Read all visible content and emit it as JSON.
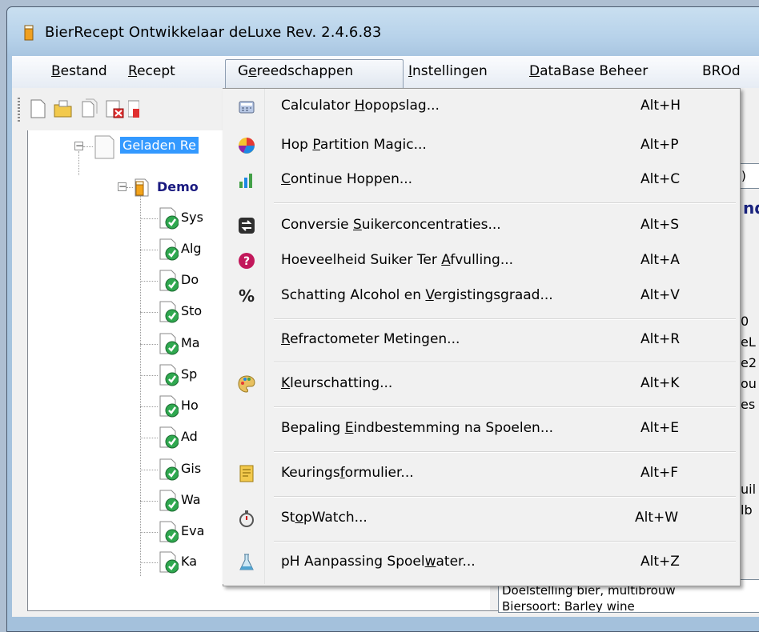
{
  "window": {
    "title": "BierRecept Ontwikkelaar deLuxe Rev. 2.4.6.83"
  },
  "menubar": {
    "items": [
      {
        "label": "Bestand",
        "mnemonic": "B",
        "rest": "estand"
      },
      {
        "label": "Recept",
        "mnemonic": "R",
        "rest": "ecept"
      },
      {
        "label": "Gereedschappen",
        "pre": "G",
        "mnemonic": "e",
        "rest": "reedschappen"
      },
      {
        "label": "Instellingen",
        "mnemonic": "I",
        "rest": "nstellingen"
      },
      {
        "label": "DataBase Beheer",
        "mnemonic": "D",
        "rest": "ataBase Beheer"
      },
      {
        "label": "BROd"
      }
    ]
  },
  "tree": {
    "root_label": "Geladen Re",
    "demo_label": "Demo",
    "children": [
      "Sys",
      "Alg",
      "Do",
      "Sto",
      "Ma",
      "Sp",
      "Ho",
      "Ad",
      "Gis",
      "Wa",
      "Eva",
      "Ka"
    ]
  },
  "right_panel": {
    "field_text": "M)",
    "frag_nd": "nd",
    "frags": [
      "0",
      "eL",
      "e2",
      "ou",
      "es",
      "uil",
      "lb"
    ],
    "bottom_line1": "Doelstelling bier, multibrouw",
    "bottom_line2": "Biersoort: Barley wine"
  },
  "dropdown": {
    "items": [
      {
        "pre": "Calculator ",
        "mn": "H",
        "post": "opopslag...",
        "accel": "Alt+H",
        "icon": "calculator-icon"
      },
      {
        "pre": "Hop ",
        "mn": "P",
        "post": "artition Magic...",
        "accel": "Alt+P",
        "icon": "pie-chart-icon"
      },
      {
        "pre": "",
        "mn": "C",
        "post": "ontinue Hoppen...",
        "accel": "Alt+C",
        "icon": "bar-chart-icon"
      },
      {
        "pre": "Conversie ",
        "mn": "S",
        "post": "uikerconcentraties...",
        "accel": "Alt+S",
        "icon": "convert-icon"
      },
      {
        "pre": "Hoeveelheid Suiker Ter ",
        "mn": "A",
        "post": "fvulling...",
        "accel": "Alt+A",
        "icon": "help-icon"
      },
      {
        "pre": "Schatting Alcohol en ",
        "mn": "V",
        "post": "ergistingsgraad...",
        "accel": "Alt+V",
        "icon": "percent-icon"
      },
      {
        "pre": "",
        "mn": "R",
        "post": "efractometer Metingen...",
        "accel": "Alt+R",
        "icon": ""
      },
      {
        "pre": "",
        "mn": "K",
        "post": "leurschatting...",
        "accel": "Alt+K",
        "icon": "palette-icon"
      },
      {
        "pre": "Bepaling ",
        "mn": "E",
        "post": "indbestemming na Spoelen...",
        "accel": "Alt+E",
        "icon": ""
      },
      {
        "pre": "Keurings",
        "mn": "f",
        "post": "ormulier...",
        "accel": "Alt+F",
        "icon": "form-icon"
      },
      {
        "pre": "St",
        "mn": "o",
        "post": "pWatch...",
        "accel": "Alt+W",
        "icon": "stopwatch-icon"
      },
      {
        "pre": "pH Aanpassing Spoel",
        "mn": "w",
        "post": "ater...",
        "accel": "Alt+Z",
        "icon": "flask-icon"
      }
    ]
  }
}
